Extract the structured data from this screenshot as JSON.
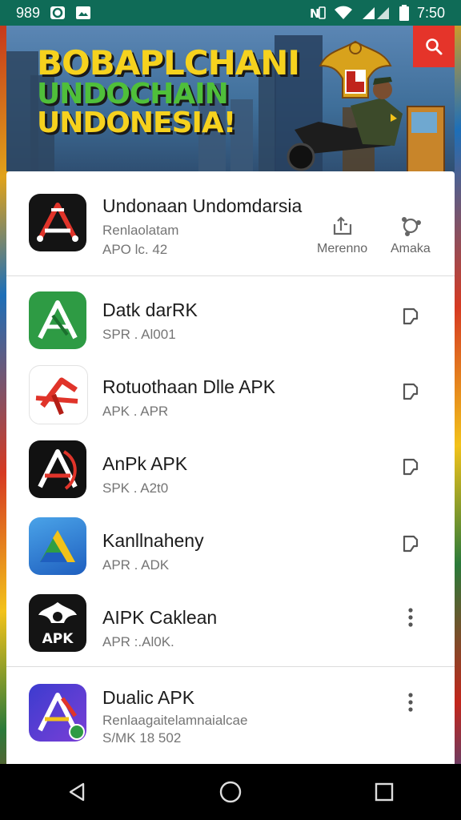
{
  "status_bar": {
    "left_text": "989",
    "time": "7:50",
    "icons": [
      "app-o-icon",
      "image-icon",
      "nfc-icon",
      "wifi-icon",
      "signal-icon",
      "battery-icon"
    ]
  },
  "banner": {
    "line1": "BOBAPLCHANI",
    "line2": "UNDOCHAIN",
    "line3": "UNDONESIA!",
    "search_icon": "search-icon",
    "accent": "#e5342a"
  },
  "featured": {
    "name": "Undonaan Undomdarsia",
    "subtitle": "Renlaolatam",
    "meta": "APO lc. 42",
    "actions": [
      {
        "label": "Merenno",
        "icon": "share-icon"
      },
      {
        "label": "Amaka",
        "icon": "network-icon"
      }
    ]
  },
  "apps": [
    {
      "name": "Datk darRK",
      "sub": "SPR . Al001",
      "action_icon": "tag-icon"
    },
    {
      "name": "Rotuothaan Dlle APK",
      "sub": "APK . APR",
      "action_icon": "tag-icon"
    },
    {
      "name": "AnPk APK",
      "sub": "SPK . A2t0",
      "action_icon": "tag-icon"
    },
    {
      "name": "Kanllnaheny",
      "sub": "APR . ADK",
      "action_icon": "tag-icon"
    },
    {
      "name": "AIPK Caklean",
      "sub": "APR :.Al0K.",
      "action_icon": "more-icon"
    },
    {
      "name": "Dualic APK",
      "sub": "Renlaagaitelamnaialcae",
      "meta": "S/MK 18 502",
      "action_icon": "more-icon"
    }
  ],
  "apk_badge": "APK",
  "nav": [
    "back-icon",
    "home-icon",
    "recents-icon"
  ],
  "colors": {
    "status_bar": "#0f6b57",
    "text_primary": "#1c1c1c",
    "text_secondary": "#757575"
  }
}
